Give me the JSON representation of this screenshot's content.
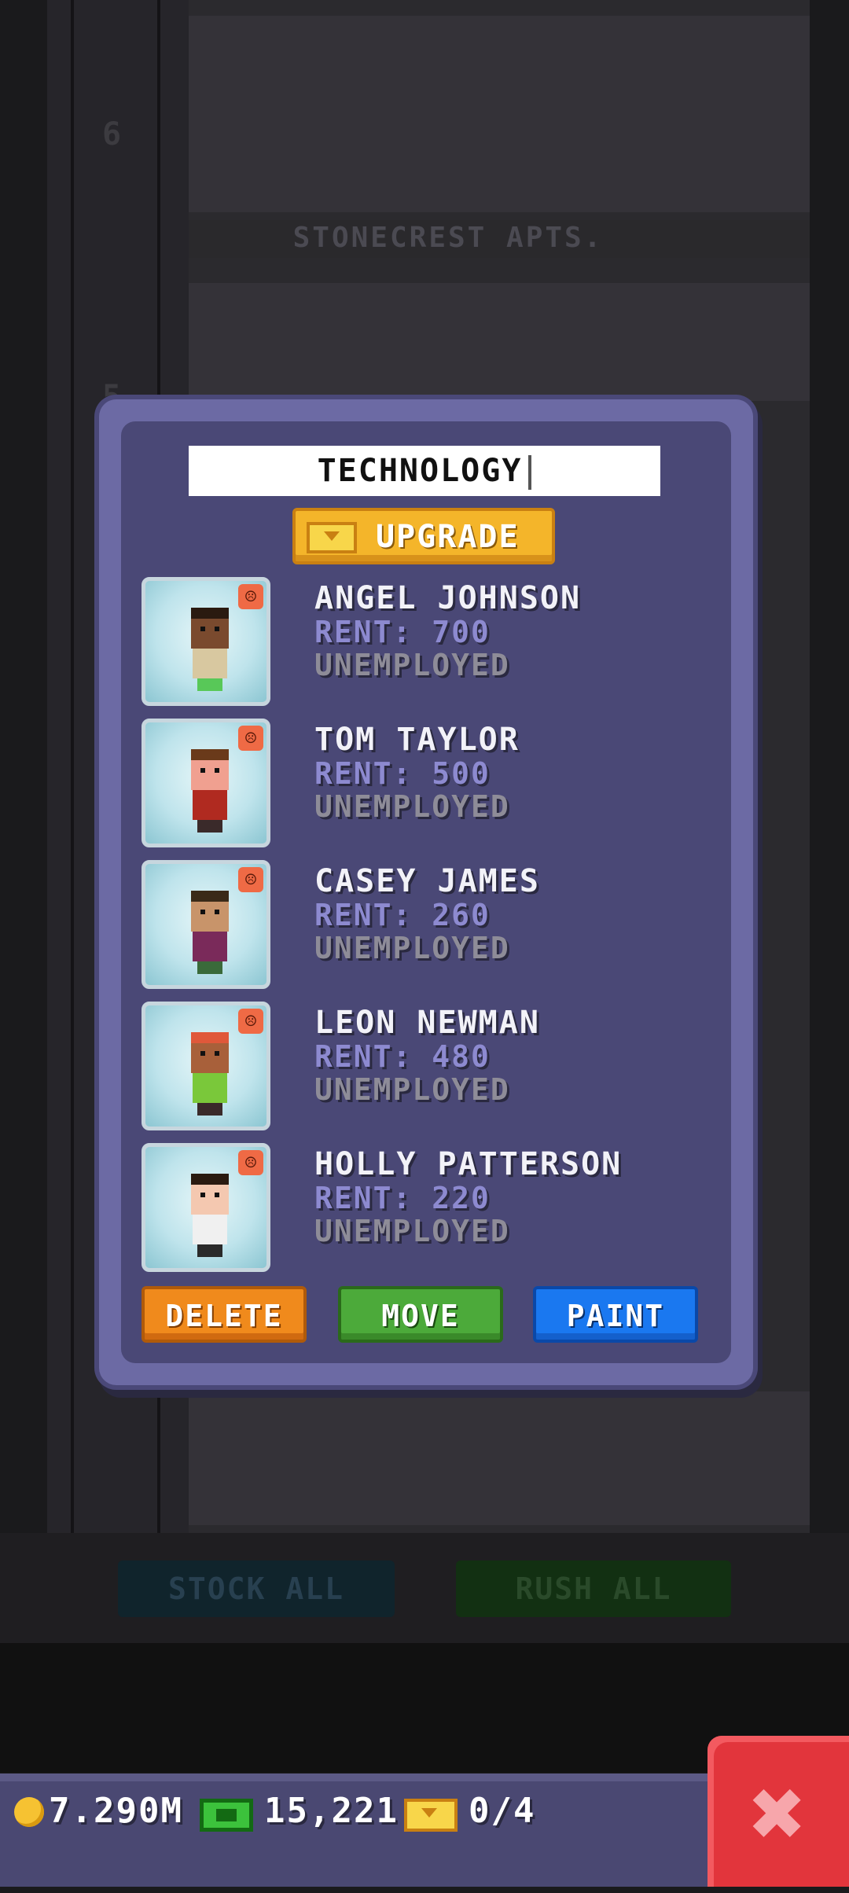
{
  "background": {
    "floor_title": "STONECREST APTS.",
    "floor_numbers": [
      "6",
      "5"
    ],
    "stock_all_label": "STOCK ALL",
    "rush_all_label": "RUSH ALL"
  },
  "dialog": {
    "name_field_value": "TECHNOLOGY",
    "upgrade_label": "UPGRADE",
    "residents": [
      {
        "name": "ANGEL JOHNSON",
        "rent": "RENT: 700",
        "job": "UNEMPLOYED",
        "skin": "#7a4a2e",
        "hair": "#2a1a10",
        "shirt": "#d8c8a0",
        "legs": "#58c858"
      },
      {
        "name": "TOM TAYLOR",
        "rent": "RENT: 500",
        "job": "UNEMPLOYED",
        "skin": "#f0a090",
        "hair": "#6a3a1a",
        "shirt": "#b02a20",
        "legs": "#3a2a2a"
      },
      {
        "name": "CASEY JAMES",
        "rent": "RENT: 260",
        "job": "UNEMPLOYED",
        "skin": "#c8946a",
        "hair": "#3a2a18",
        "shirt": "#7a2a5a",
        "legs": "#3a6a3a"
      },
      {
        "name": "LEON NEWMAN",
        "rent": "RENT: 480",
        "job": "UNEMPLOYED",
        "skin": "#a8603a",
        "hair": "#e0583a",
        "shirt": "#7ac83a",
        "legs": "#3a2a2a"
      },
      {
        "name": "HOLLY PATTERSON",
        "rent": "RENT: 220",
        "job": "UNEMPLOYED",
        "skin": "#f4c8b0",
        "hair": "#2a1a10",
        "shirt": "#f0f0f0",
        "legs": "#2a2a2a"
      }
    ],
    "delete_label": "DELETE",
    "move_label": "MOVE",
    "paint_label": "PAINT"
  },
  "currency": {
    "coins": "7.290M",
    "bux": "15,221",
    "tickets": "0/4"
  },
  "colors": {
    "dialog": "#6c6aa4",
    "dialog_inner": "#4a4876",
    "upgrade": "#f4b52a",
    "delete": "#f08a1c",
    "move": "#4caa3a",
    "paint": "#1a78f0",
    "close": "#e2353c"
  }
}
